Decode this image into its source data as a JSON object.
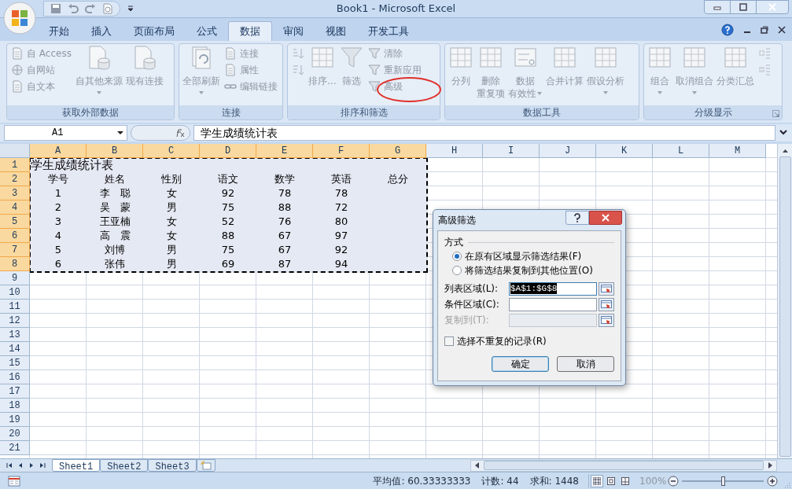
{
  "window": {
    "title": "Book1 - Microsoft Excel"
  },
  "tabs": [
    {
      "label": "开始",
      "selected": false
    },
    {
      "label": "插入",
      "selected": false
    },
    {
      "label": "页面布局",
      "selected": false
    },
    {
      "label": "公式",
      "selected": false
    },
    {
      "label": "数据",
      "selected": true
    },
    {
      "label": "审阅",
      "selected": false
    },
    {
      "label": "视图",
      "selected": false
    },
    {
      "label": "开发工具",
      "selected": false
    }
  ],
  "ribbon": {
    "groups": [
      {
        "label": "获取外部数据",
        "launcher": false,
        "items": [
          {
            "kind": "small",
            "label": "自 Access",
            "disabled": true
          },
          {
            "kind": "small",
            "label": "自网站",
            "disabled": true
          },
          {
            "kind": "small",
            "label": "自文本",
            "disabled": true
          },
          {
            "kind": "large",
            "label": "自其他来源",
            "dropdown": true,
            "disabled": true
          },
          {
            "kind": "large",
            "label": "现有连接",
            "dropdown": false,
            "disabled": true
          }
        ]
      },
      {
        "label": "连接",
        "launcher": false,
        "items": [
          {
            "kind": "large",
            "label": "全部刷新",
            "dropdown": true,
            "disabled": true
          },
          {
            "kind": "small",
            "label": "连接",
            "disabled": true
          },
          {
            "kind": "small",
            "label": "属性",
            "disabled": true
          },
          {
            "kind": "small",
            "label": "编辑链接",
            "disabled": true
          }
        ]
      },
      {
        "label": "排序和筛选",
        "launcher": false,
        "items": [
          {
            "kind": "icon",
            "disabled": true
          },
          {
            "kind": "icon",
            "disabled": true
          },
          {
            "kind": "large",
            "label": "排序...",
            "dropdown": false,
            "disabled": true
          },
          {
            "kind": "large",
            "label": "筛选",
            "dropdown": false,
            "disabled": true
          },
          {
            "kind": "small",
            "label": "清除",
            "disabled": true
          },
          {
            "kind": "small",
            "label": "重新应用",
            "disabled": true
          },
          {
            "kind": "small",
            "label": "高级",
            "disabled": true
          }
        ]
      },
      {
        "label": "数据工具",
        "launcher": false,
        "items": [
          {
            "kind": "large",
            "label": "分列",
            "dropdown": false,
            "disabled": true
          },
          {
            "kind": "large",
            "label": "删除",
            "label2": "重复项",
            "dropdown": false,
            "disabled": true
          },
          {
            "kind": "large",
            "label": "数据",
            "label2": "有效性",
            "dropdown": true,
            "disabled": true
          },
          {
            "kind": "large",
            "label": "合并计算",
            "dropdown": false,
            "disabled": true
          },
          {
            "kind": "large",
            "label": "假设分析",
            "dropdown": true,
            "disabled": true
          }
        ]
      },
      {
        "label": "分级显示",
        "launcher": true,
        "items": [
          {
            "kind": "large",
            "label": "组合",
            "dropdown": true,
            "disabled": true
          },
          {
            "kind": "large",
            "label": "取消组合",
            "dropdown": true,
            "disabled": true
          },
          {
            "kind": "large",
            "label": "分类汇总",
            "dropdown": false,
            "disabled": true
          },
          {
            "kind": "icon",
            "disabled": true
          },
          {
            "kind": "icon",
            "disabled": true
          }
        ]
      }
    ]
  },
  "formula_bar": {
    "name_box": "A1",
    "formula": "学生成绩统计表"
  },
  "sheet": {
    "columns": [
      {
        "label": "A",
        "selected": true
      },
      {
        "label": "B",
        "selected": true
      },
      {
        "label": "C",
        "selected": true
      },
      {
        "label": "D",
        "selected": true
      },
      {
        "label": "E",
        "selected": true
      },
      {
        "label": "F",
        "selected": true
      },
      {
        "label": "G",
        "selected": true
      },
      {
        "label": "H",
        "selected": false
      },
      {
        "label": "I",
        "selected": false
      },
      {
        "label": "J",
        "selected": false
      },
      {
        "label": "K",
        "selected": false
      },
      {
        "label": "L",
        "selected": false
      },
      {
        "label": "M",
        "selected": false
      }
    ],
    "rows": [
      {
        "label": "1",
        "selected": true,
        "cells": [
          "学生成绩统计表"
        ]
      },
      {
        "label": "2",
        "selected": true,
        "cells": [
          "学号",
          "姓名",
          "性别",
          "语文",
          "数学",
          "英语",
          "总分"
        ]
      },
      {
        "label": "3",
        "selected": true,
        "cells": [
          "1",
          "李　聪",
          "女",
          "92",
          "78",
          "78"
        ]
      },
      {
        "label": "4",
        "selected": true,
        "cells": [
          "2",
          "吴　蒙",
          "男",
          "75",
          "88",
          "72"
        ]
      },
      {
        "label": "5",
        "selected": true,
        "cells": [
          "3",
          "王亚楠",
          "女",
          "52",
          "76",
          "80"
        ]
      },
      {
        "label": "6",
        "selected": true,
        "cells": [
          "4",
          "高　震",
          "女",
          "88",
          "67",
          "97"
        ]
      },
      {
        "label": "7",
        "selected": true,
        "cells": [
          "5",
          "刘博",
          "男",
          "75",
          "67",
          "92"
        ]
      },
      {
        "label": "8",
        "selected": true,
        "cells": [
          "6",
          "张伟",
          "男",
          "69",
          "87",
          "94"
        ]
      },
      {
        "label": "9",
        "selected": false
      },
      {
        "label": "10",
        "selected": false
      },
      {
        "label": "11",
        "selected": false
      },
      {
        "label": "12",
        "selected": false
      },
      {
        "label": "13",
        "selected": false
      },
      {
        "label": "14",
        "selected": false
      },
      {
        "label": "15",
        "selected": false
      },
      {
        "label": "16",
        "selected": false
      },
      {
        "label": "17",
        "selected": false
      },
      {
        "label": "18",
        "selected": false
      },
      {
        "label": "19",
        "selected": false
      },
      {
        "label": "20",
        "selected": false
      },
      {
        "label": "21",
        "selected": false
      }
    ]
  },
  "dialog": {
    "title": "高级筛选",
    "section": "方式",
    "radios": [
      {
        "label": "在原有区域显示筛选结果(F)",
        "selected": true
      },
      {
        "label": "将筛选结果复制到其他位置(O)",
        "selected": false
      }
    ],
    "fields": [
      {
        "label": "列表区域(L):",
        "value": "$A$1:$G$8",
        "highlighted": true,
        "disabled": false
      },
      {
        "label": "条件区域(C):",
        "disabled": false
      },
      {
        "label": "复制到(T):",
        "disabled": true
      }
    ],
    "checkbox": {
      "label": "选择不重复的记录(R)",
      "checked": false
    },
    "buttons": [
      {
        "label": "确定",
        "default": true
      },
      {
        "label": "取消",
        "default": false
      }
    ]
  },
  "sheet_tabs": [
    {
      "label": "Sheet1",
      "selected": true
    },
    {
      "label": "Sheet2",
      "selected": false
    },
    {
      "label": "Sheet3",
      "selected": false
    }
  ],
  "status_bar": {
    "average": "平均值: 60.33333333",
    "count": "计数: 44",
    "sum": "求和: 1448",
    "zoom": "100%",
    "zoom_level": {
      "level": 0.5
    }
  }
}
